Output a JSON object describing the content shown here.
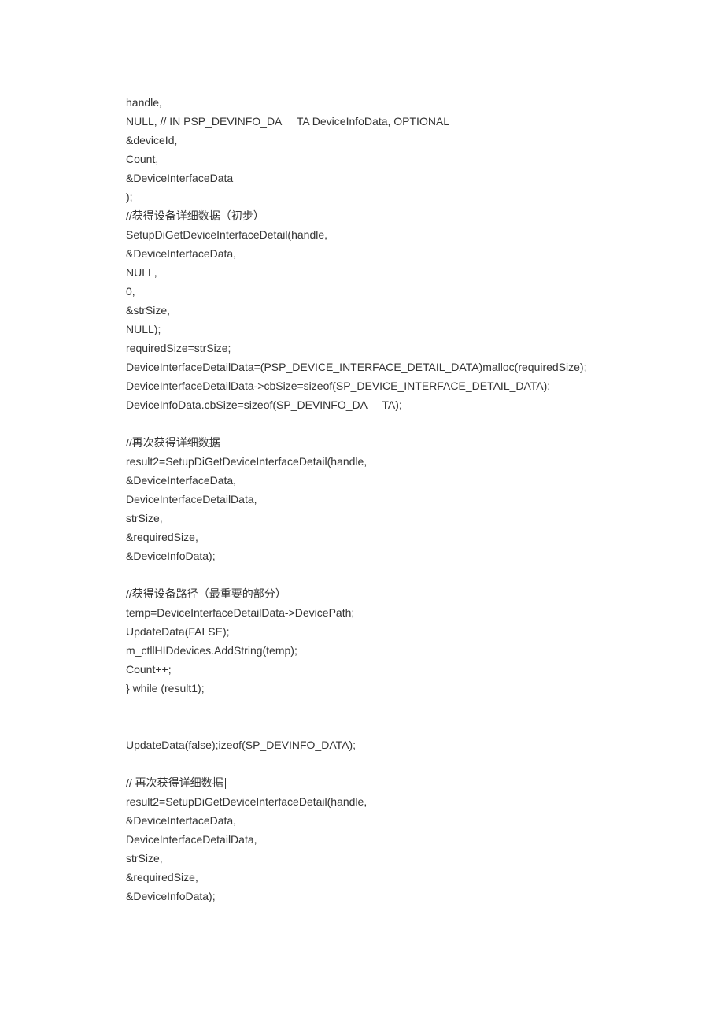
{
  "lines": [
    "handle,",
    "NULL, // IN PSP_DEVINFO_DA     TA DeviceInfoData, OPTIONAL",
    "&deviceId,",
    "Count,",
    "&DeviceInterfaceData",
    ");",
    "//获得设备详细数据（初步）",
    "SetupDiGetDeviceInterfaceDetail(handle,",
    "&DeviceInterfaceData,",
    "NULL,",
    "0,",
    "&strSize,",
    "NULL);",
    "requiredSize=strSize;",
    "DeviceInterfaceDetailData=(PSP_DEVICE_INTERFACE_DETAIL_DATA)malloc(requiredSize);",
    "DeviceInterfaceDetailData->cbSize=sizeof(SP_DEVICE_INTERFACE_DETAIL_DATA);",
    "DeviceInfoData.cbSize=sizeof(SP_DEVINFO_DA     TA);",
    "",
    "//再次获得详细数据",
    "result2=SetupDiGetDeviceInterfaceDetail(handle,",
    "&DeviceInterfaceData,",
    "DeviceInterfaceDetailData,",
    "strSize,",
    "&requiredSize,",
    "&DeviceInfoData);",
    "",
    "//获得设备路径（最重要的部分）",
    "temp=DeviceInterfaceDetailData->DevicePath;",
    "UpdateData(FALSE);",
    "m_ctllHIDdevices.AddString(temp);",
    "Count++;",
    "} while (result1);",
    "",
    "",
    "UpdateData(false);izeof(SP_DEVINFO_DATA);",
    "",
    "// 再次获得详细数据",
    "result2=SetupDiGetDeviceInterfaceDetail(handle,",
    "&DeviceInterfaceData,",
    "DeviceInterfaceDetailData,",
    "strSize,",
    "&requiredSize,",
    "&DeviceInfoData);"
  ],
  "cursor_line_index": 36
}
